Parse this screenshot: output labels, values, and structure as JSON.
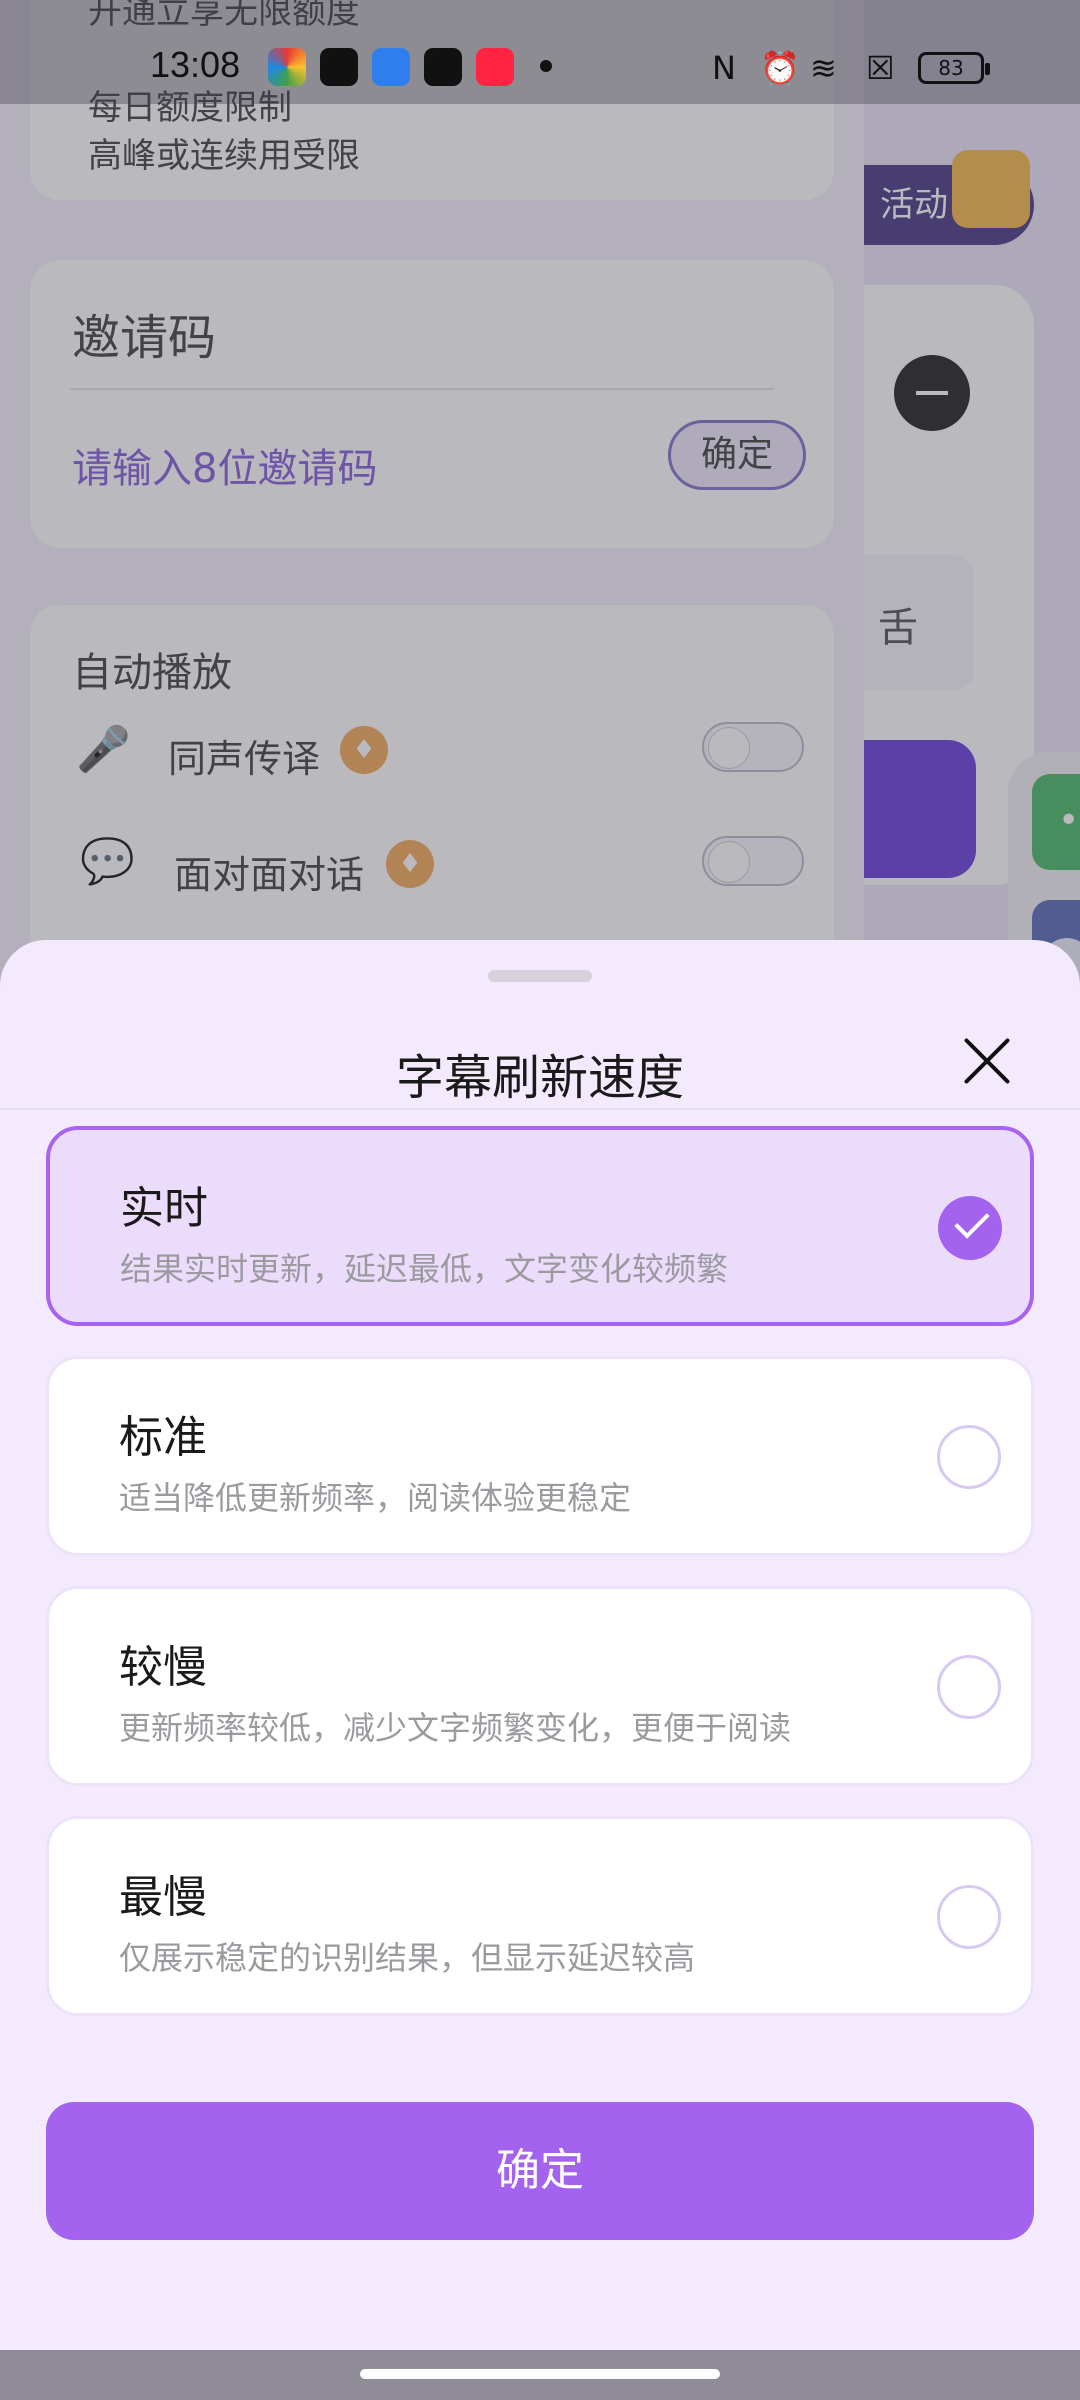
{
  "status_bar": {
    "time": "13:08",
    "battery": "83",
    "icons": [
      "nfc-icon",
      "alarm-icon",
      "wifi-icon",
      "no-sim-icon"
    ]
  },
  "background": {
    "quota_line1": "开通立享无限额度",
    "quota_line2": "每日额度限制",
    "quota_line3": "高峰或连续用受限",
    "invite_title": "邀请码",
    "invite_placeholder": "请输入8位邀请码",
    "invite_confirm": "确定",
    "auto_play_title": "自动播放",
    "auto_item1": "同声传译",
    "auto_item2": "面对面对话",
    "promo_label": "活动",
    "select_text": "舌"
  },
  "sheet": {
    "title": "字幕刷新速度",
    "options": [
      {
        "title": "实时",
        "desc": "结果实时更新，延迟最低，文字变化较频繁",
        "selected": true
      },
      {
        "title": "标准",
        "desc": "适当降低更新频率，阅读体验更稳定",
        "selected": false
      },
      {
        "title": "较慢",
        "desc": "更新频率较低，减少文字频繁变化，更便于阅读",
        "selected": false
      },
      {
        "title": "最慢",
        "desc": "仅展示稳定的识别结果，但显示延迟较高",
        "selected": false
      }
    ],
    "confirm_label": "确定"
  },
  "colors": {
    "accent": "#a463ef",
    "selected_bg": "#ecdcfc",
    "sheet_bg": "#f3ebfd"
  }
}
